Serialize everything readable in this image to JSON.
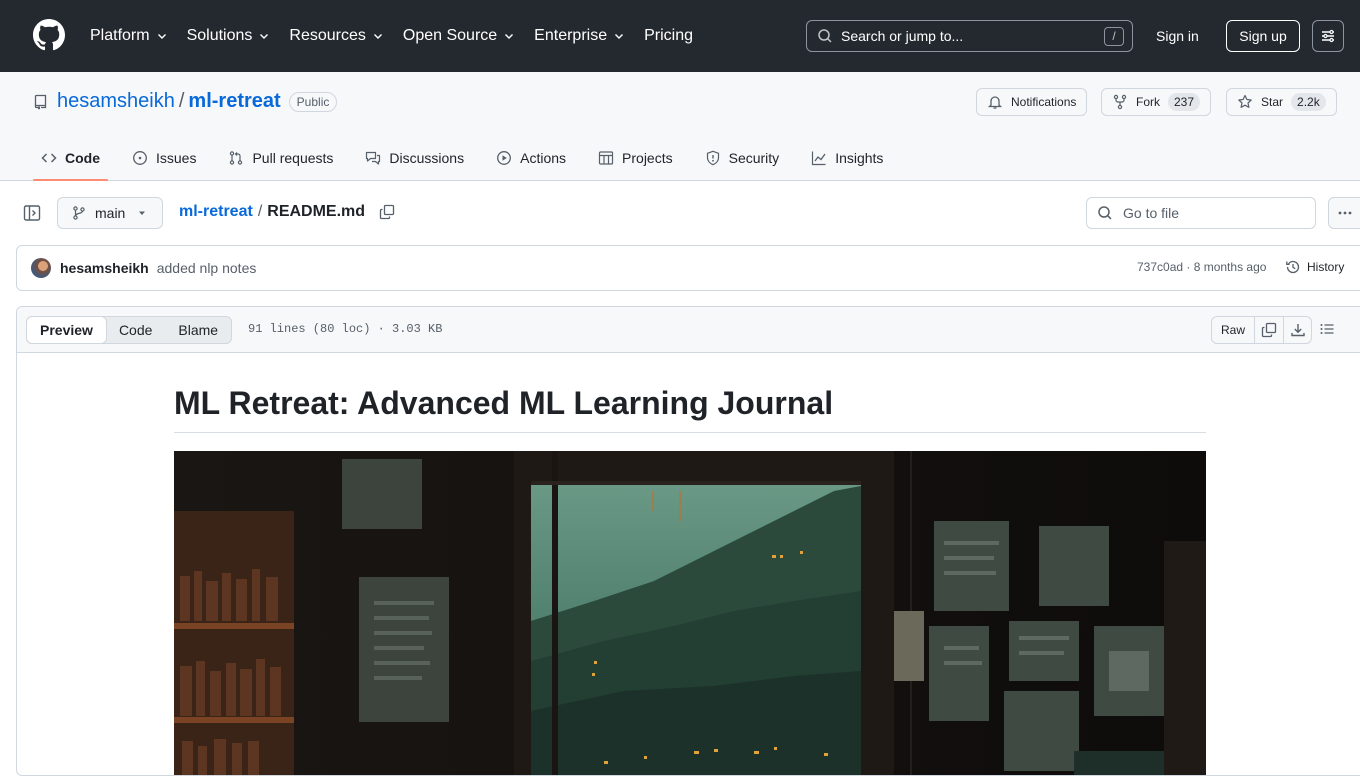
{
  "header": {
    "nav": [
      {
        "label": "Platform",
        "chevron": true
      },
      {
        "label": "Solutions",
        "chevron": true
      },
      {
        "label": "Resources",
        "chevron": true
      },
      {
        "label": "Open Source",
        "chevron": true
      },
      {
        "label": "Enterprise",
        "chevron": true
      },
      {
        "label": "Pricing",
        "chevron": false
      }
    ],
    "search_placeholder": "Search or jump to...",
    "search_shortcut": "/",
    "sign_in": "Sign in",
    "sign_up": "Sign up"
  },
  "repo": {
    "owner": "hesamsheikh",
    "separator": "/",
    "name": "ml-retreat",
    "visibility": "Public",
    "notifications_label": "Notifications",
    "fork_label": "Fork",
    "fork_count": "237",
    "star_label": "Star",
    "star_count": "2.2k",
    "tabs": [
      {
        "label": "Code",
        "icon": "code-icon",
        "active": true
      },
      {
        "label": "Issues",
        "icon": "issue-icon",
        "active": false
      },
      {
        "label": "Pull requests",
        "icon": "pull-request-icon",
        "active": false
      },
      {
        "label": "Discussions",
        "icon": "discussion-icon",
        "active": false
      },
      {
        "label": "Actions",
        "icon": "play-icon",
        "active": false
      },
      {
        "label": "Projects",
        "icon": "table-icon",
        "active": false
      },
      {
        "label": "Security",
        "icon": "shield-icon",
        "active": false
      },
      {
        "label": "Insights",
        "icon": "graph-icon",
        "active": false
      }
    ]
  },
  "file_bar": {
    "branch": "main",
    "crumb_repo": "ml-retreat",
    "crumb_sep": "/",
    "crumb_file": "README.md",
    "goto_placeholder": "Go to file"
  },
  "commit": {
    "author": "hesamsheikh",
    "message": "added nlp notes",
    "meta": "737c0ad · 8 months ago",
    "history_label": "History"
  },
  "file_view": {
    "modes": [
      "Preview",
      "Code",
      "Blame"
    ],
    "active_mode": "Preview",
    "info": "91 lines (80 loc) · 3.03 KB",
    "raw_label": "Raw"
  },
  "readme": {
    "title": "ML Retreat: Advanced ML Learning Journal"
  },
  "colors": {
    "header_bg": "#24292f",
    "link": "#0969da",
    "active_tab_underline": "#fd8c73"
  }
}
